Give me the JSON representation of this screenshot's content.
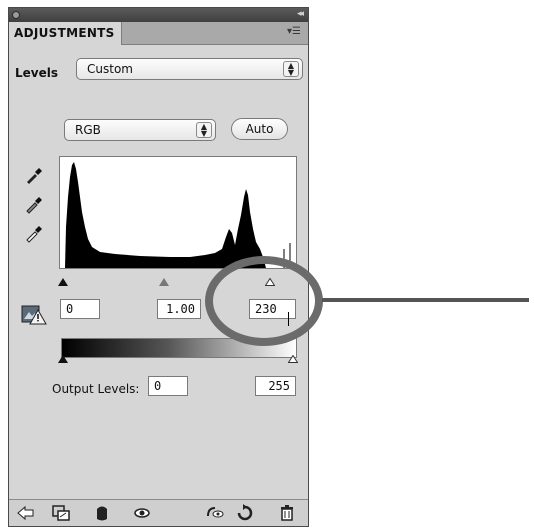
{
  "panel": {
    "tab_label": "ADJUSTMENTS",
    "levels_label": "Levels",
    "preset": {
      "selected": "Custom"
    },
    "channel": {
      "selected": "RGB"
    },
    "auto_label": "Auto"
  },
  "input_levels": {
    "black": "0",
    "gamma": "1.00",
    "white": "230"
  },
  "output_levels": {
    "label": "Output Levels:",
    "black": "0",
    "white": "255"
  },
  "icons": {
    "eyedroppers": [
      "black-point-eyedropper-icon",
      "gray-point-eyedropper-icon",
      "white-point-eyedropper-icon"
    ],
    "bottom_bar": [
      "back-arrow-icon",
      "clip-to-layer-icon",
      "mask-icon",
      "visibility-eye-icon",
      "view-previous-state-icon",
      "reset-icon",
      "trash-icon"
    ]
  },
  "colors": {
    "panel_bg": "#d6d6d6",
    "highlight_ring": "#6b6b6b"
  }
}
